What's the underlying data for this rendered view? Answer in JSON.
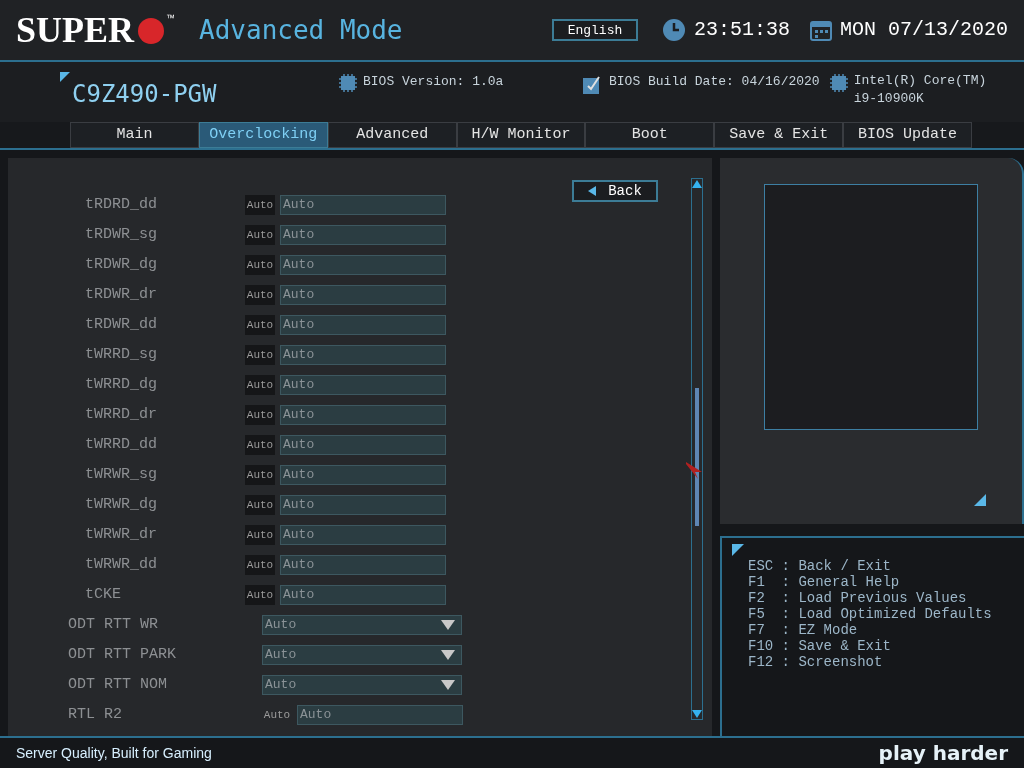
{
  "header": {
    "logo": "SUPER",
    "logo_mark": "™",
    "mode": "Advanced Mode",
    "language": "English",
    "time": "23:51:38",
    "date": "MON 07/13/2020"
  },
  "info": {
    "model": "C9Z490-PGW",
    "bios_version": "BIOS Version: 1.0a",
    "build_date": "BIOS Build Date: 04/16/2020",
    "cpu": [
      "Intel(R) Core(TM)",
      "i9-10900K"
    ]
  },
  "tabs": [
    {
      "label": "Main",
      "selected": false
    },
    {
      "label": "Overclocking",
      "selected": true
    },
    {
      "label": "Advanced",
      "selected": false
    },
    {
      "label": "H/W Monitor",
      "selected": false
    },
    {
      "label": "Boot",
      "selected": false
    },
    {
      "label": "Save & Exit",
      "selected": false
    },
    {
      "label": "BIOS Update",
      "selected": false
    }
  ],
  "back_button": "Back",
  "settings": [
    {
      "kind": "sub_field",
      "label": "tRDRD_dd",
      "badge": "Auto",
      "value": "Auto"
    },
    {
      "kind": "sub_field",
      "label": "tRDWR_sg",
      "badge": "Auto",
      "value": "Auto"
    },
    {
      "kind": "sub_field",
      "label": "tRDWR_dg",
      "badge": "Auto",
      "value": "Auto"
    },
    {
      "kind": "sub_field",
      "label": "tRDWR_dr",
      "badge": "Auto",
      "value": "Auto"
    },
    {
      "kind": "sub_field",
      "label": "tRDWR_dd",
      "badge": "Auto",
      "value": "Auto"
    },
    {
      "kind": "sub_field",
      "label": "tWRRD_sg",
      "badge": "Auto",
      "value": "Auto"
    },
    {
      "kind": "sub_field",
      "label": "tWRRD_dg",
      "badge": "Auto",
      "value": "Auto"
    },
    {
      "kind": "sub_field",
      "label": "tWRRD_dr",
      "badge": "Auto",
      "value": "Auto"
    },
    {
      "kind": "sub_field",
      "label": "tWRRD_dd",
      "badge": "Auto",
      "value": "Auto"
    },
    {
      "kind": "sub_field",
      "label": "tWRWR_sg",
      "badge": "Auto",
      "value": "Auto"
    },
    {
      "kind": "sub_field",
      "label": "tWRWR_dg",
      "badge": "Auto",
      "value": "Auto"
    },
    {
      "kind": "sub_field",
      "label": "tWRWR_dr",
      "badge": "Auto",
      "value": "Auto"
    },
    {
      "kind": "sub_field",
      "label": "tWRWR_dd",
      "badge": "Auto",
      "value": "Auto"
    },
    {
      "kind": "sub_field",
      "label": "tCKE",
      "badge": "Auto",
      "value": "Auto"
    },
    {
      "kind": "dropdown",
      "label": "ODT RTT WR",
      "value": "Auto"
    },
    {
      "kind": "dropdown",
      "label": "ODT RTT PARK",
      "value": "Auto"
    },
    {
      "kind": "dropdown",
      "label": "ODT RTT NOM",
      "value": "Auto"
    },
    {
      "kind": "field",
      "label": "RTL R2",
      "badge": "Auto",
      "value": "Auto"
    }
  ],
  "help_keys": [
    "ESC : Back / Exit",
    "F1  : General Help",
    "F2  : Load Previous Values",
    "F5  : Load Optimized Defaults",
    "F7  : EZ Mode",
    "F10 : Save & Exit",
    "F12 : Screenshot"
  ],
  "footer": {
    "slogan": "Server Quality, Built for Gaming",
    "brand": "play harder"
  }
}
